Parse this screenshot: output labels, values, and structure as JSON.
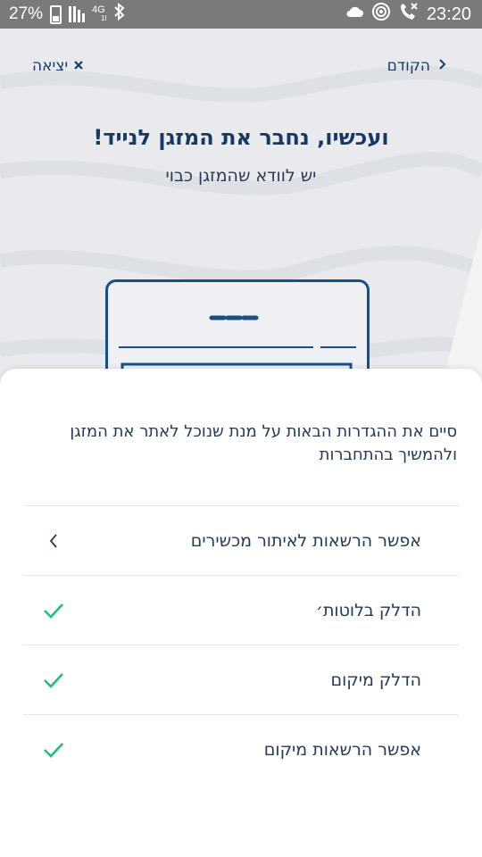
{
  "status_bar": {
    "battery_percent": "27%",
    "network": "4G",
    "network_sub": "1l",
    "time": "23:20",
    "icons": [
      "battery-icon",
      "signal-icon",
      "bluetooth-icon",
      "cloud-icon",
      "vpn-icon",
      "missed-call-icon"
    ]
  },
  "nav": {
    "back_label": "הקודם",
    "exit_label": "יציאה"
  },
  "header": {
    "title": "ועכשיו, נחבר את המזגן לנייד!",
    "subtitle": "יש לוודא שהמזגן כבוי"
  },
  "sheet": {
    "intro": "סיים את ההגדרות הבאות על מנת שנוכל לאתר את המזגן ולהמשיך בהתחברות",
    "items": [
      {
        "label": "אפשר הרשאות לאיתור מכשירים",
        "status": "pending",
        "icon": "chevron-left-icon"
      },
      {
        "label": "הדלק בלוטות׳",
        "status": "done",
        "icon": "check-icon"
      },
      {
        "label": "הדלק מיקום",
        "status": "done",
        "icon": "check-icon"
      },
      {
        "label": "אפשר הרשאות מיקום",
        "status": "done",
        "icon": "check-icon"
      }
    ]
  },
  "colors": {
    "primary_text": "#163a63",
    "check_green": "#22c07a",
    "device_outline": "#1a4e85"
  }
}
